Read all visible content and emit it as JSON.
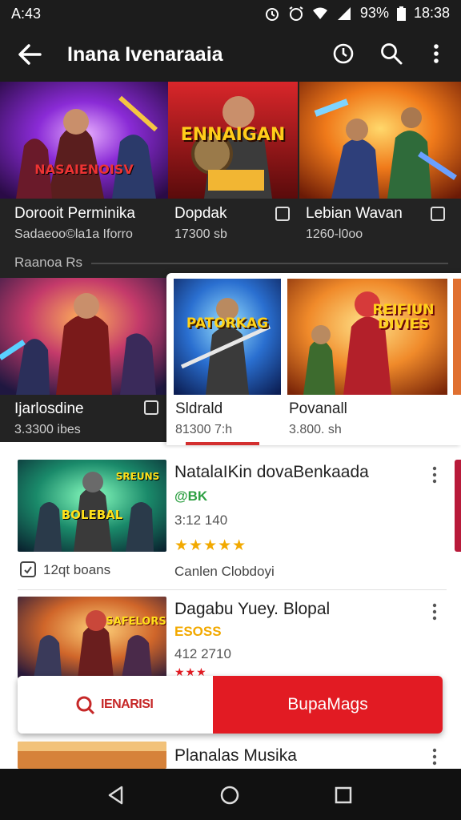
{
  "status_bar": {
    "time": "A:43",
    "battery": "93%",
    "clock": "18:38"
  },
  "app_bar": {
    "title": "Inana Ivenaraaia"
  },
  "top_row": [
    {
      "art_text": "NASAIENOISV",
      "title": "Dorooit Perminika",
      "subtitle": "Sadaeoo©la1a Iforro"
    },
    {
      "art_text": "ENNAIGAN",
      "title": "Dopdak",
      "subtitle": "17300 sb"
    },
    {
      "art_text": "",
      "title": "Lebian Wavan",
      "subtitle": "1260-l0oo"
    }
  ],
  "section": {
    "label": "Raanoa Rs"
  },
  "second_row": [
    {
      "art_text": "",
      "title": "Ijarlosdine",
      "subtitle": "3.3300 ibes"
    },
    {
      "art_text": "PATORKAG",
      "title": "Sldrald",
      "subtitle": "81300 7:h"
    },
    {
      "art_text": "REIFIUN DIVIES",
      "title": "Povanall",
      "subtitle": "3.800. sh"
    }
  ],
  "list_items": [
    {
      "title": "NatalaIKin dovaBenkaada",
      "tag": "@BK",
      "sub": "3:12 140",
      "stars": "★★★★★",
      "art_text": "BOLEBAL",
      "art_text2": "SREUNS",
      "footer_left": "12qt boans",
      "footer_right": "Canlen Clobdoyi"
    },
    {
      "title": "Dagabu Yuey. Blopal",
      "tag": "ESOSS",
      "sub": "412 2710",
      "stars": "★★★",
      "art_text": "SAFELORS"
    },
    {
      "title": "Planalas Musika"
    }
  ],
  "action_bar": {
    "left_label": "IENARISI",
    "right_label": "BupaMags"
  },
  "colors": {
    "accent": "#e21b23",
    "dark_bg": "#232323",
    "star_gold": "#f2a900",
    "star_green": "#2ea043"
  }
}
